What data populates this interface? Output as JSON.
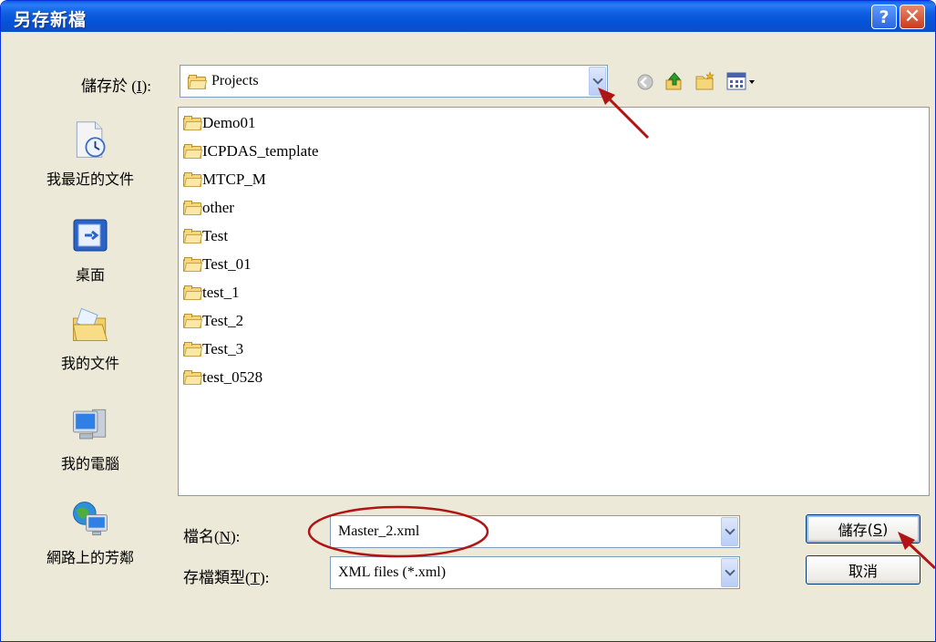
{
  "window": {
    "title": "另存新檔"
  },
  "titlebar": {
    "help_label": "?",
    "close_label": "✕"
  },
  "location": {
    "label": "儲存於",
    "accel": "(I)",
    "accel_letter": "I",
    "value": "Projects"
  },
  "places": [
    {
      "label": "我最近的文件",
      "icon": "recent-documents-icon"
    },
    {
      "label": "桌面",
      "icon": "desktop-icon"
    },
    {
      "label": "我的文件",
      "icon": "my-documents-icon"
    },
    {
      "label": "我的電腦",
      "icon": "my-computer-icon"
    },
    {
      "label": "網路上的芳鄰",
      "icon": "network-places-icon"
    }
  ],
  "files": [
    "Demo01",
    "ICPDAS_template",
    "MTCP_M",
    "other",
    "Test",
    "Test_01",
    "test_1",
    "Test_2",
    "Test_3",
    "test_0528"
  ],
  "filename": {
    "label": "檔名",
    "accel": "N",
    "value": "Master_2.xml"
  },
  "filetype": {
    "label": "存檔類型",
    "accel": "T",
    "value": "XML files (*.xml)"
  },
  "buttons": {
    "save": "儲存",
    "save_accel": "S",
    "cancel": "取消"
  },
  "colors": {
    "titlebar": "#0a5ce8",
    "annotation": "#b01515",
    "face": "#ece9d8"
  }
}
